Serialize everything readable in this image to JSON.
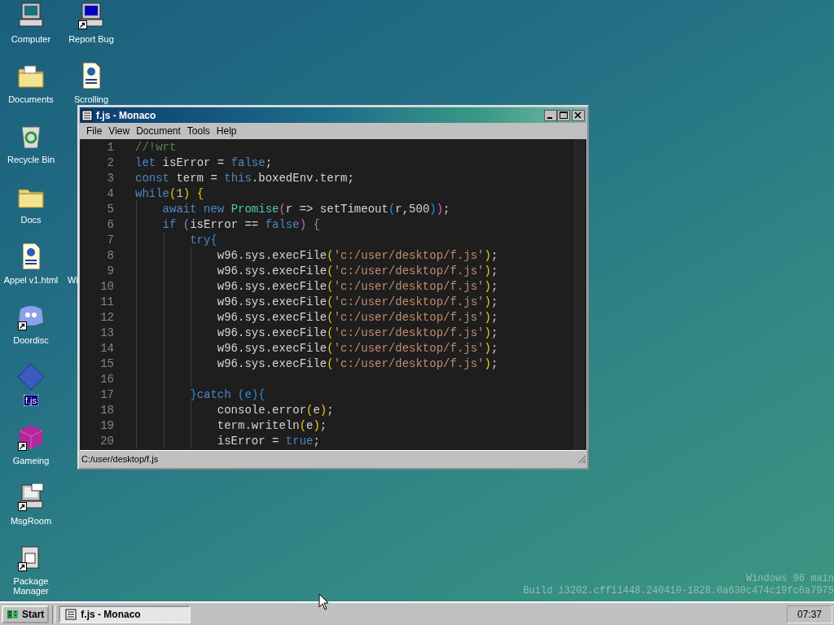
{
  "desktop_icons": [
    {
      "label": "Computer",
      "kind": "computer",
      "shortcut": false,
      "selected": false
    },
    {
      "label": "Report Bug",
      "kind": "bluescreen",
      "shortcut": true,
      "selected": false
    },
    {
      "label": "Documents",
      "kind": "docfolder",
      "shortcut": false,
      "selected": false
    },
    {
      "label": "Scrolling",
      "kind": "webpage",
      "shortcut": false,
      "selected": false
    },
    {
      "label": "Recycle Bin",
      "kind": "recycle",
      "shortcut": false,
      "selected": false
    },
    {
      "label": "Docs",
      "kind": "folder",
      "shortcut": false,
      "selected": false
    },
    {
      "label": "Appel v1.html",
      "kind": "webpage",
      "shortcut": false,
      "selected": false
    },
    {
      "label": "Wi",
      "kind": "hidden",
      "selected": false
    },
    {
      "label": "Doordisc",
      "kind": "chat",
      "shortcut": true,
      "selected": false
    },
    {
      "label": "f.js",
      "kind": "diamond",
      "shortcut": false,
      "selected": true
    },
    {
      "label": "Gameing",
      "kind": "cube",
      "shortcut": true,
      "selected": false
    },
    {
      "label": "MsgRoom",
      "kind": "msgroom",
      "shortcut": true,
      "selected": false
    },
    {
      "label": "Package Manager",
      "kind": "package",
      "shortcut": true,
      "selected": false
    }
  ],
  "window": {
    "title": "f.js - Monaco",
    "menu": [
      "File",
      "View",
      "Document",
      "Tools",
      "Help"
    ],
    "editor": {
      "lines": [
        {
          "number": "1",
          "tokens": [
            {
              "kind": "comment",
              "text": "//!wrt"
            }
          ]
        },
        {
          "number": "2",
          "tokens": [
            {
              "kind": "keyword",
              "text": "let"
            },
            {
              "kind": "plain",
              "text": " isError = "
            },
            {
              "kind": "keyword",
              "text": "false"
            },
            {
              "kind": "plain",
              "text": ";"
            }
          ]
        },
        {
          "number": "3",
          "tokens": [
            {
              "kind": "keyword",
              "text": "const"
            },
            {
              "kind": "plain",
              "text": " term = "
            },
            {
              "kind": "keyword",
              "text": "this"
            },
            {
              "kind": "plain",
              "text": ".boxedEnv.term;"
            }
          ]
        },
        {
          "number": "4",
          "tokens": [
            {
              "kind": "keyword",
              "text": "while"
            },
            {
              "kind": "paren",
              "text": "("
            },
            {
              "kind": "number",
              "text": "1"
            },
            {
              "kind": "paren",
              "text": ") {"
            }
          ]
        },
        {
          "number": "5",
          "tokens": [
            {
              "kind": "keyword",
              "text": "    await new "
            },
            {
              "kind": "class",
              "text": "Promise"
            },
            {
              "kind": "paren2",
              "text": "("
            },
            {
              "kind": "plain",
              "text": "r => setTimeout"
            },
            {
              "kind": "paren3",
              "text": "("
            },
            {
              "kind": "plain",
              "text": "r,500"
            },
            {
              "kind": "paren3",
              "text": ")"
            },
            {
              "kind": "paren2",
              "text": ")"
            },
            {
              "kind": "plain",
              "text": ";"
            }
          ]
        },
        {
          "number": "6",
          "tokens": [
            {
              "kind": "keyword",
              "text": "    if "
            },
            {
              "kind": "paren2",
              "text": "("
            },
            {
              "kind": "plain",
              "text": "isError == "
            },
            {
              "kind": "keyword",
              "text": "false"
            },
            {
              "kind": "paren2",
              "text": ") {"
            }
          ]
        },
        {
          "number": "7",
          "tokens": [
            {
              "kind": "keyword",
              "text": "        try"
            },
            {
              "kind": "paren3",
              "text": "{"
            }
          ]
        },
        {
          "number": "8",
          "tokens": [
            {
              "kind": "plain",
              "text": "            w96.sys.execFile"
            },
            {
              "kind": "paren",
              "text": "("
            },
            {
              "kind": "string",
              "text": "'c:/user/desktop/f.js'"
            },
            {
              "kind": "paren",
              "text": ")"
            },
            {
              "kind": "plain",
              "text": ";"
            }
          ]
        },
        {
          "number": "9",
          "tokens": [
            {
              "kind": "plain",
              "text": "            w96.sys.execFile"
            },
            {
              "kind": "paren",
              "text": "("
            },
            {
              "kind": "string",
              "text": "'c:/user/desktop/f.js'"
            },
            {
              "kind": "paren",
              "text": ")"
            },
            {
              "kind": "plain",
              "text": ";"
            }
          ]
        },
        {
          "number": "10",
          "tokens": [
            {
              "kind": "plain",
              "text": "            w96.sys.execFile"
            },
            {
              "kind": "paren",
              "text": "("
            },
            {
              "kind": "string",
              "text": "'c:/user/desktop/f.js'"
            },
            {
              "kind": "paren",
              "text": ")"
            },
            {
              "kind": "plain",
              "text": ";"
            }
          ]
        },
        {
          "number": "11",
          "tokens": [
            {
              "kind": "plain",
              "text": "            w96.sys.execFile"
            },
            {
              "kind": "paren",
              "text": "("
            },
            {
              "kind": "string",
              "text": "'c:/user/desktop/f.js'"
            },
            {
              "kind": "paren",
              "text": ")"
            },
            {
              "kind": "plain",
              "text": ";"
            }
          ]
        },
        {
          "number": "12",
          "tokens": [
            {
              "kind": "plain",
              "text": "            w96.sys.execFile"
            },
            {
              "kind": "paren",
              "text": "("
            },
            {
              "kind": "string",
              "text": "'c:/user/desktop/f.js'"
            },
            {
              "kind": "paren",
              "text": ")"
            },
            {
              "kind": "plain",
              "text": ";"
            }
          ]
        },
        {
          "number": "13",
          "tokens": [
            {
              "kind": "plain",
              "text": "            w96.sys.execFile"
            },
            {
              "kind": "paren",
              "text": "("
            },
            {
              "kind": "string",
              "text": "'c:/user/desktop/f.js'"
            },
            {
              "kind": "paren",
              "text": ")"
            },
            {
              "kind": "plain",
              "text": ";"
            }
          ]
        },
        {
          "number": "14",
          "tokens": [
            {
              "kind": "plain",
              "text": "            w96.sys.execFile"
            },
            {
              "kind": "paren",
              "text": "("
            },
            {
              "kind": "string",
              "text": "'c:/user/desktop/f.js'"
            },
            {
              "kind": "paren",
              "text": ")"
            },
            {
              "kind": "plain",
              "text": ";"
            }
          ]
        },
        {
          "number": "15",
          "tokens": [
            {
              "kind": "plain",
              "text": "            w96.sys.execFile"
            },
            {
              "kind": "paren",
              "text": "("
            },
            {
              "kind": "string",
              "text": "'c:/user/desktop/f.js'"
            },
            {
              "kind": "paren",
              "text": ")"
            },
            {
              "kind": "plain",
              "text": ";"
            }
          ]
        },
        {
          "number": "16"
        },
        {
          "number": "17",
          "tokens": [
            {
              "kind": "paren3",
              "text": "        }"
            },
            {
              "kind": "keyword",
              "text": "catch"
            },
            {
              "kind": "paren3",
              "text": " (e){"
            }
          ]
        },
        {
          "number": "18",
          "tokens": [
            {
              "kind": "plain",
              "text": "            console.error"
            },
            {
              "kind": "paren",
              "text": "("
            },
            {
              "kind": "plain",
              "text": "e"
            },
            {
              "kind": "paren",
              "text": ")"
            },
            {
              "kind": "plain",
              "text": ";"
            }
          ]
        },
        {
          "number": "19",
          "tokens": [
            {
              "kind": "plain",
              "text": "            term.writeln"
            },
            {
              "kind": "paren",
              "text": "("
            },
            {
              "kind": "plain",
              "text": "e"
            },
            {
              "kind": "paren",
              "text": ")"
            },
            {
              "kind": "plain",
              "text": ";"
            }
          ]
        },
        {
          "number": "20",
          "tokens": [
            {
              "kind": "plain",
              "text": "            isError = "
            },
            {
              "kind": "keyword",
              "text": "true"
            },
            {
              "kind": "plain",
              "text": ";"
            }
          ]
        }
      ]
    },
    "status_bar": "C:/user/desktop/f.js"
  },
  "build_info": [
    "Windows 96 main",
    "Build i3202.cff11448.240410-1828.0a630c474c19fc6a7975"
  ],
  "taskbar": {
    "start": "Start",
    "tasks": [
      {
        "label": "f.js - Monaco",
        "selected": true
      }
    ],
    "clock": "07:37"
  }
}
